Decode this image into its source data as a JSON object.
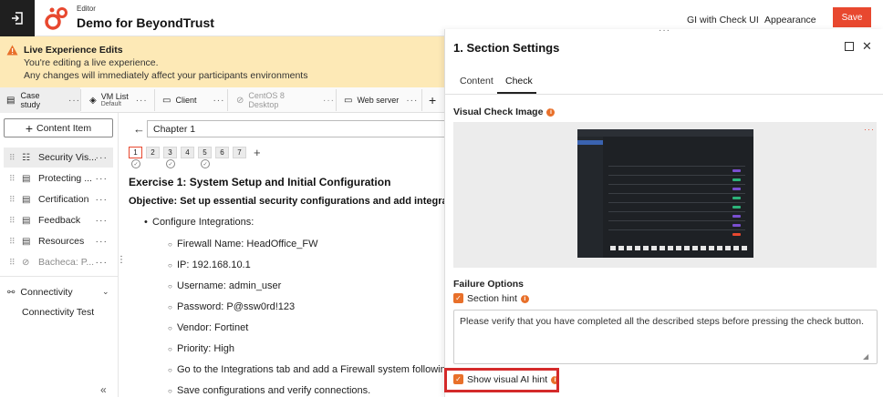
{
  "topbar": {
    "editor_label": "Editor",
    "title": "Demo for BeyondTrust",
    "gi_check": "GI with Check UI",
    "appearance": "Appearance",
    "save_label": "Save",
    "brand_color": "#e8482f"
  },
  "banner": {
    "title": "Live Experience Edits",
    "line1": "You're editing a live experience.",
    "line2": "Any changes will immediately affect your participants environments"
  },
  "vm_tabs": [
    {
      "label": "Case study",
      "icon": "book-icon"
    },
    {
      "label": "VM List",
      "sub": "Default",
      "icon": "cube-icon"
    },
    {
      "label": "Client",
      "icon": "monitor-icon"
    },
    {
      "label": "CentOS 8 Desktop",
      "icon": "link-icon"
    },
    {
      "label": "Web server",
      "icon": "monitor-icon"
    }
  ],
  "sidebar": {
    "add_label": "Content Item",
    "items": [
      {
        "label": "Security Vis..."
      },
      {
        "label": "Protecting ..."
      },
      {
        "label": "Certification"
      },
      {
        "label": "Feedback"
      },
      {
        "label": "Resources"
      },
      {
        "label": "Bacheca: P..."
      }
    ],
    "connectivity": "Connectivity",
    "connectivity_test": "Connectivity Test"
  },
  "editor": {
    "chapter": "Chapter 1",
    "pages": [
      "1",
      "2",
      "3",
      "4",
      "5",
      "6",
      "7"
    ],
    "title": "Exercise 1: System Setup and Initial Configuration",
    "objective": "Objective: Set up essential security  configurations and add integrations",
    "bullet": "Configure Integrations:",
    "subs": [
      "Firewall Name: HeadOffice_FW",
      "IP: 192.168.10.1",
      "Username: admin_user",
      "Password: P@ssw0rd!123",
      "Vendor: Fortinet",
      "Priority: High",
      "Go to the Integrations tab and add a Firewall system following:",
      "Save configurations and verify connections."
    ]
  },
  "panel": {
    "title": "1. Section Settings",
    "tabs": [
      "Content",
      "Check"
    ],
    "visual_check_label": "Visual Check Image",
    "failure_options": "Failure Options",
    "section_hint": "Section hint",
    "hint_text": "Please verify that you have completed all the described steps before pressing the check button.",
    "show_visual_ai_hint": "Show visual AI hint",
    "accent_color": "#e8702a"
  }
}
